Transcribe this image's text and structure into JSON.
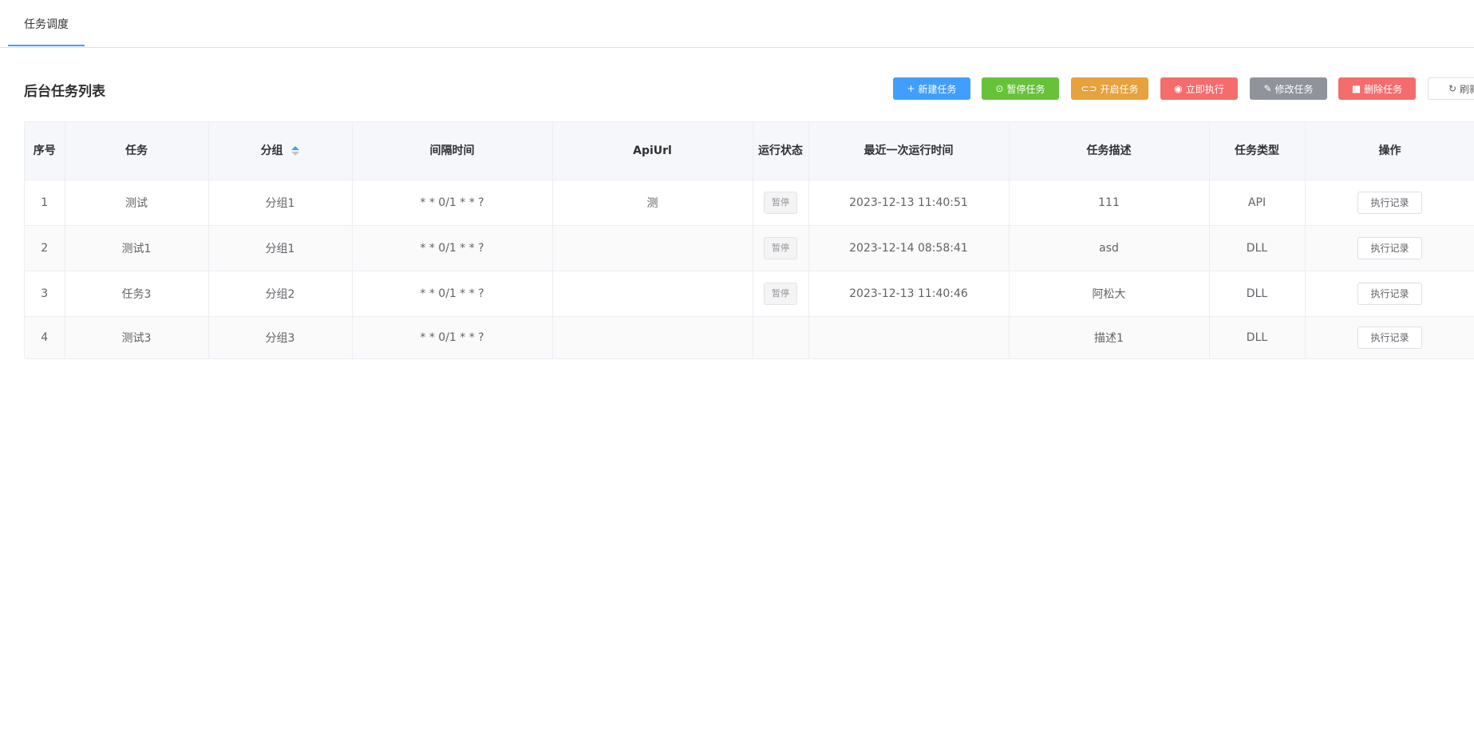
{
  "tabs": [
    {
      "label": "任务调度",
      "active": true
    }
  ],
  "list_title": "后台任务列表",
  "toolbar": {
    "new": {
      "label": "新建任务",
      "icon": "plus-icon"
    },
    "pause": {
      "label": "暂停任务",
      "icon": "pause-circle-icon"
    },
    "start": {
      "label": "开启任务",
      "icon": "toggle-icon"
    },
    "run": {
      "label": "立即执行",
      "icon": "play-circle-icon"
    },
    "edit": {
      "label": "修改任务",
      "icon": "edit-icon"
    },
    "delete": {
      "label": "删除任务",
      "icon": "trash-icon"
    },
    "refresh": {
      "label": "刷新",
      "icon": "refresh-icon"
    }
  },
  "table": {
    "headers": {
      "index": "序号",
      "task": "任务",
      "group": "分组",
      "interval": "间隔时间",
      "apiurl": "ApiUrl",
      "status": "运行状态",
      "last_run": "最近一次运行时间",
      "description": "任务描述",
      "type": "任务类型",
      "action": "操作"
    },
    "rows": [
      {
        "index": "1",
        "task": "测试",
        "group": "分组1",
        "interval": "* * 0/1 * * ?",
        "apiurl": "测",
        "status": "暂停",
        "last_run": "2023-12-13 11:40:51",
        "description": "111",
        "type": "API",
        "action": "执行记录"
      },
      {
        "index": "2",
        "task": "测试1",
        "group": "分组1",
        "interval": "* * 0/1 * * ?",
        "apiurl": "",
        "status": "暂停",
        "last_run": "2023-12-14 08:58:41",
        "description": "asd",
        "type": "DLL",
        "action": "执行记录"
      },
      {
        "index": "3",
        "task": "任务3",
        "group": "分组2",
        "interval": "* * 0/1 * * ?",
        "apiurl": "",
        "status": "暂停",
        "last_run": "2023-12-13 11:40:46",
        "description": "阿松大",
        "type": "DLL",
        "action": "执行记录"
      },
      {
        "index": "4",
        "task": "测试3",
        "group": "分组3",
        "interval": "* * 0/1 * * ?",
        "apiurl": "",
        "status": "",
        "last_run": "",
        "description": "描述1",
        "type": "DLL",
        "action": "执行记录"
      }
    ]
  },
  "colors": {
    "primary": "#409eff",
    "success": "#67c23a",
    "warning": "#e6a23c",
    "danger": "#f56c6c",
    "info": "#909399"
  }
}
